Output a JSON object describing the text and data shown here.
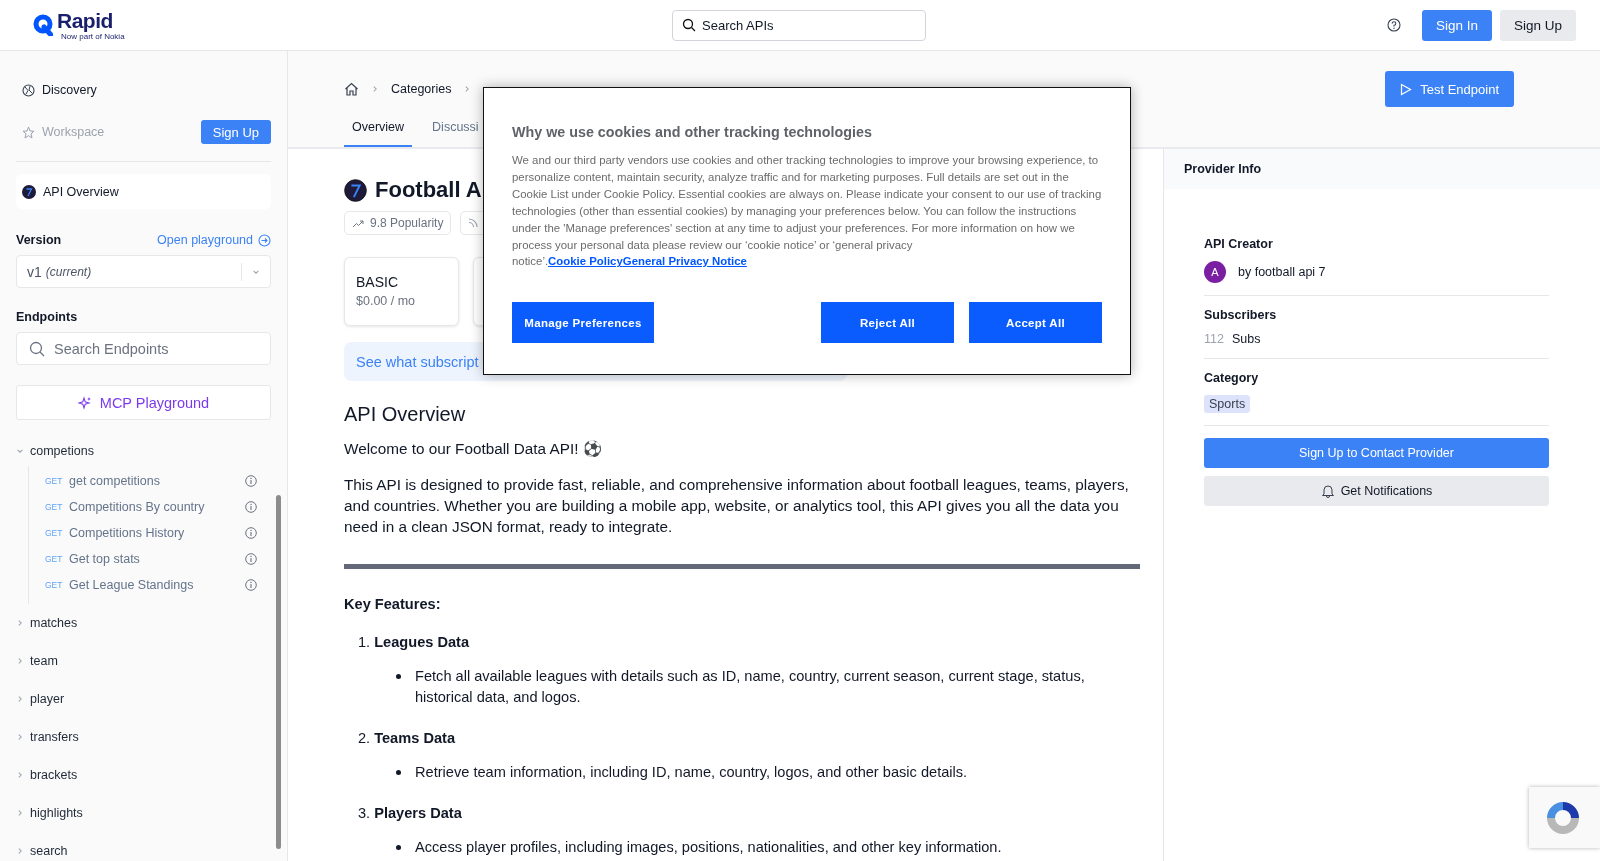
{
  "header": {
    "logo": "Rapid",
    "tagline": "Now part of Nokia",
    "search": {
      "placeholder": "Search APIs"
    },
    "buttons": [
      {
        "label": "Sign In",
        "kind": "primary"
      },
      {
        "label": "Sign Up",
        "kind": "secondary"
      }
    ]
  },
  "sidebar": {
    "nav": [
      {
        "label": "Discovery",
        "disabled": false
      },
      {
        "label": "Workspace",
        "disabled": true
      }
    ],
    "signup_button": "Sign Up",
    "api_overview": "API Overview",
    "version": {
      "label": "Version",
      "link": "Open playground",
      "value": "v1",
      "note": "(current)"
    },
    "endpoints": {
      "label": "Endpoints",
      "search": {
        "placeholder": "Search Endpoints"
      },
      "mcp_button": "MCP Playground",
      "groups": [
        {
          "name": "competions",
          "expanded": true,
          "children": [
            {
              "method": "GET",
              "name": "get competitions"
            },
            {
              "method": "GET",
              "name": "Competitions By country"
            },
            {
              "method": "GET",
              "name": "Competitions History"
            },
            {
              "method": "GET",
              "name": "Get top stats"
            },
            {
              "method": "GET",
              "name": "Get League Standings"
            }
          ]
        },
        {
          "name": "matches",
          "expanded": false
        },
        {
          "name": "team",
          "expanded": false
        },
        {
          "name": "player",
          "expanded": false
        },
        {
          "name": "transfers",
          "expanded": false
        },
        {
          "name": "brackets",
          "expanded": false
        },
        {
          "name": "highlights",
          "expanded": false
        },
        {
          "name": "search",
          "expanded": false
        }
      ]
    }
  },
  "breadcrumb": [
    "Categories"
  ],
  "tabs": [
    {
      "label": "Overview",
      "selected": true
    },
    {
      "label": "Discussi",
      "selected": false
    }
  ],
  "test_button": "Test Endpoint",
  "api": {
    "title": "Football A",
    "popularity": "9.8 Popularity",
    "plans": [
      {
        "name": "BASIC",
        "price": "$0.00 / mo"
      }
    ],
    "banner": "See what subscript"
  },
  "overview": {
    "heading": "API Overview",
    "welcome": "Welcome to our Football Data API! ⚽",
    "intro": "This API is designed to provide fast, reliable, and comprehensive information about football leagues, teams, players, and countries. Whether you are building a mobile app, website, or analytics tool, this API gives you all the data you need in a clean JSON format, ready to integrate.",
    "features_heading": "Key Features:",
    "features": [
      {
        "number": "1.",
        "title": "Leagues Data",
        "items": [
          "Fetch all available leagues with details such as ID, name, country, current season, current stage, status, historical data, and logos."
        ]
      },
      {
        "number": "2.",
        "title": "Teams Data",
        "items": [
          "Retrieve team information, including ID, name, country, logos, and other basic details."
        ]
      },
      {
        "number": "3.",
        "title": "Players Data",
        "items": [
          "Access player profiles, including images, positions, nationalities, and other key information."
        ]
      }
    ]
  },
  "provider": {
    "title": "Provider Info",
    "creator_label": "API Creator",
    "avatar": "A",
    "creator": "by football api 7",
    "subscribers_label": "Subscribers",
    "subscribers": "112",
    "subs_unit": "Subs",
    "category_label": "Category",
    "category": "Sports",
    "contact_button": "Sign Up to Contact Provider",
    "notify_button": "Get Notifications"
  },
  "cookie_modal": {
    "title": "Why we use cookies and other tracking technologies",
    "body": "We and our third party vendors use cookies and other tracking technologies to improve your browsing experience, to personalize content, maintain security, analyze traffic and for marketing purposes. Full details are set out in the Cookie List under Cookie Policy. Essential cookies are always on. Please indicate your consent to our use of tracking technologies (other than essential cookies) by managing your preferences below. You can follow the instructions under the 'Manage preferences' section at any time to adjust your preferences. For more information on how we process your personal data please review our ‘cookie notice’ or ‘general privacy notice’.",
    "links": [
      "Cookie Policy",
      "General Privacy Notice"
    ],
    "buttons": [
      "Manage Preferences",
      "Reject All",
      "Accept All"
    ]
  }
}
